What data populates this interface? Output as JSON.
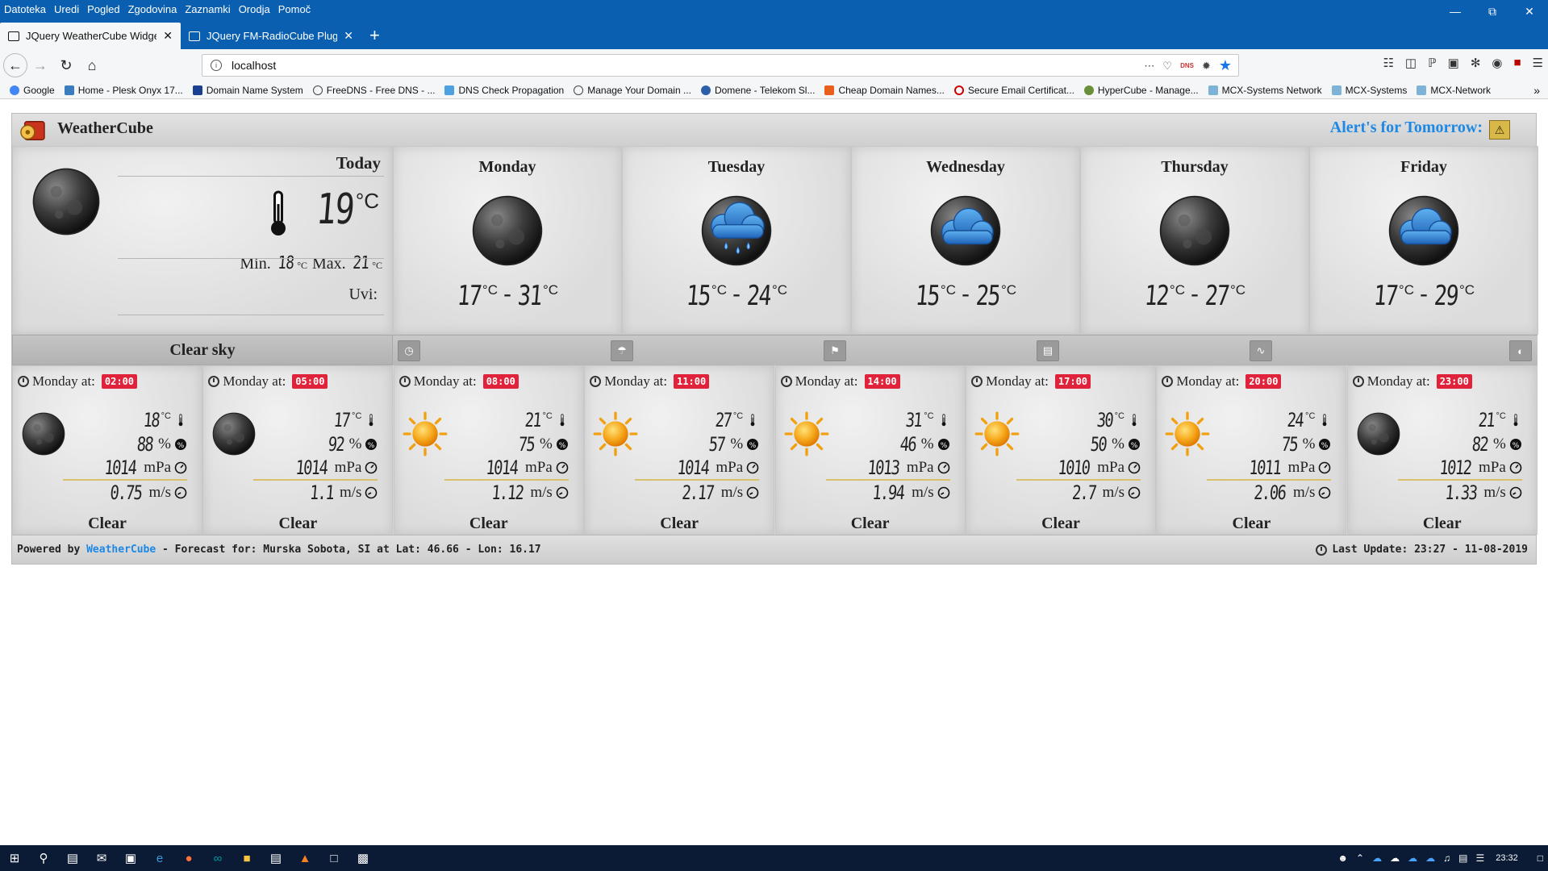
{
  "browser": {
    "menu": [
      "Datoteka",
      "Uredi",
      "Pogled",
      "Zgodovina",
      "Zaznamki",
      "Orodja",
      "Pomoč"
    ],
    "tabs": [
      {
        "label": "JQuery WeatherCube Widget",
        "active": true
      },
      {
        "label": "JQuery FM-RadioCube Plugin",
        "active": false
      }
    ],
    "url": "localhost",
    "dns_badge": "DNS",
    "bookmarks": [
      "Google",
      "Home - Plesk Onyx 17...",
      "Domain Name System",
      "FreeDNS - Free DNS - ...",
      "DNS Check Propagation",
      "Manage Your Domain ...",
      "Domene - Telekom Sl...",
      "Cheap Domain Names...",
      "Secure Email Certificat...",
      "HyperCube - Manage...",
      "MCX-Systems Network",
      "MCX-Systems",
      "MCX-Network"
    ]
  },
  "widget": {
    "title": "WeatherCube",
    "alert_label": "Alert's for Tomorrow:",
    "today": {
      "label": "Today",
      "temp": "19",
      "unit": "°C",
      "min_label": "Min.",
      "min": "18",
      "max_label": "Max.",
      "max": "21",
      "uvi_label": "Uvi:",
      "description": "Clear sky"
    },
    "days": [
      {
        "name": "Monday",
        "min": "17",
        "max": "31",
        "icon": "moon"
      },
      {
        "name": "Tuesday",
        "min": "15",
        "max": "24",
        "icon": "rain-cloud"
      },
      {
        "name": "Wednesday",
        "min": "15",
        "max": "25",
        "icon": "cloud"
      },
      {
        "name": "Thursday",
        "min": "12",
        "max": "27",
        "icon": "moon"
      },
      {
        "name": "Friday",
        "min": "17",
        "max": "29",
        "icon": "cloud"
      }
    ],
    "hourly": [
      {
        "label": "Monday at:",
        "time": "02:00",
        "temp": "18",
        "humidity": "88",
        "pressure": "1014",
        "wind": "0.75",
        "desc": "Clear",
        "icon": "moon"
      },
      {
        "label": "Monday at:",
        "time": "05:00",
        "temp": "17",
        "humidity": "92",
        "pressure": "1014",
        "wind": "1.1",
        "desc": "Clear",
        "icon": "moon"
      },
      {
        "label": "Monday at:",
        "time": "08:00",
        "temp": "21",
        "humidity": "75",
        "pressure": "1014",
        "wind": "1.12",
        "desc": "Clear",
        "icon": "sun"
      },
      {
        "label": "Monday at:",
        "time": "11:00",
        "temp": "27",
        "humidity": "57",
        "pressure": "1014",
        "wind": "2.17",
        "desc": "Clear",
        "icon": "sun"
      },
      {
        "label": "Monday at:",
        "time": "14:00",
        "temp": "31",
        "humidity": "46",
        "pressure": "1013",
        "wind": "1.94",
        "desc": "Clear",
        "icon": "sun"
      },
      {
        "label": "Monday at:",
        "time": "17:00",
        "temp": "30",
        "humidity": "50",
        "pressure": "1010",
        "wind": "2.7",
        "desc": "Clear",
        "icon": "sun"
      },
      {
        "label": "Monday at:",
        "time": "20:00",
        "temp": "24",
        "humidity": "75",
        "pressure": "1011",
        "wind": "2.06",
        "desc": "Clear",
        "icon": "sun"
      },
      {
        "label": "Monday at:",
        "time": "23:00",
        "temp": "21",
        "humidity": "82",
        "pressure": "1012",
        "wind": "1.33",
        "desc": "Clear",
        "icon": "moon"
      }
    ],
    "units": {
      "temp": "°C",
      "humidity": "%",
      "pressure": "mPa",
      "wind": "m/s"
    },
    "footer": {
      "powered_by": "Powered by",
      "brand_link": "WeatherCube",
      "forecast_text": "- Forecast for: Murska Sobota, SI at Lat: 46.66 - Lon: 16.17",
      "last_update": "Last Update: 23:27 - 11-08-2019"
    },
    "colors": {
      "accent": "#1e88e5",
      "badge": "#e0233a",
      "header_blue": "#0a5fb0"
    }
  },
  "taskbar": {
    "clock": "23:32"
  }
}
